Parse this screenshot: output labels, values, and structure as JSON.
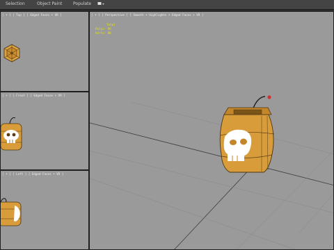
{
  "menubar": {
    "items": [
      "Selection",
      "Object Paint",
      "Populate"
    ],
    "icon": "viewport-layout-icon"
  },
  "viewports": {
    "top": {
      "label": "[ + ] [ Top ] [ Edged Faces + VR ]"
    },
    "front": {
      "label": "[ + ] [ Front ] [ Edged Faces + VR ]"
    },
    "left": {
      "label": "[ + ] [ Left ] [ Edged Faces + VR ]"
    },
    "perspective": {
      "label": "[ + ] [ Perspective ] [ Smooth + Highlights + Edged Faces + VR ]",
      "stats": {
        "title": "Total",
        "polys": "Polys: 96",
        "verts": "Verts: 88"
      }
    }
  },
  "colors": {
    "grid": "#7e7e7e",
    "barrel_wood": "#d89c3a",
    "skull": "#ffffff",
    "fuse_tip": "#cc3333"
  }
}
